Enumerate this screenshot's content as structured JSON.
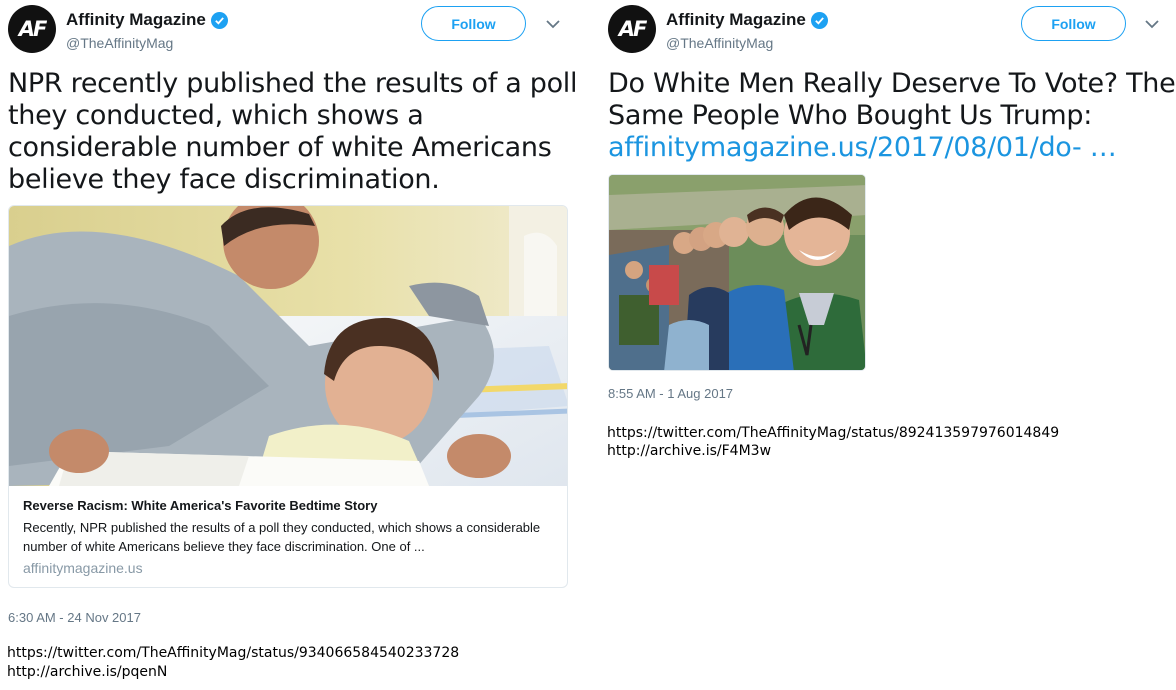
{
  "tweets": [
    {
      "account": {
        "name": "Affinity Magazine",
        "handle": "@TheAffinityMag",
        "avatar_text": "AF",
        "verified": true
      },
      "follow_label": "Follow",
      "text": "NPR recently published the results of a poll they conducted, which shows a considerable number of white Americans believe they face discrimination.",
      "card": {
        "title": "Reverse Racism: White America's Favorite Bedtime Story",
        "description": "Recently, NPR published the results of a poll they conducted, which shows a considerable number of white Americans believe they face discrimination. One of ...",
        "domain": "affinitymagazine.us"
      },
      "timestamp": "6:30 AM - 24 Nov 2017",
      "urls": [
        "https://twitter.com/TheAffinityMag/status/934066584540233728",
        "http://archive.is/pqenN"
      ]
    },
    {
      "account": {
        "name": "Affinity Magazine",
        "handle": "@TheAffinityMag",
        "avatar_text": "AF",
        "verified": true
      },
      "follow_label": "Follow",
      "text": "Do White Men Really Deserve To Vote? The Same People Who Bought Us Trump:",
      "link": "affinitymagazine.us/2017/08/01/do- …",
      "timestamp": "8:55 AM - 1 Aug 2017",
      "urls": [
        "https://twitter.com/TheAffinityMag/status/892413597976014849",
        "http://archive.is/F4M3w"
      ]
    }
  ],
  "colors": {
    "accent": "#1da1f2",
    "link": "#1b95e0",
    "muted": "#657786",
    "verified": "#1da1f2"
  },
  "icons": {
    "verified": "verified-badge-icon",
    "caret": "chevron-down-icon"
  }
}
